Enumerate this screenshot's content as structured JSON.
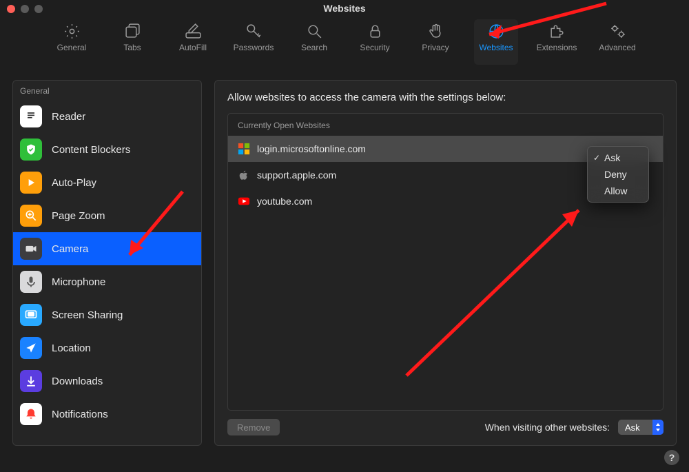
{
  "window": {
    "title": "Websites"
  },
  "toolbar": {
    "items": [
      {
        "id": "general",
        "label": "General"
      },
      {
        "id": "tabs",
        "label": "Tabs"
      },
      {
        "id": "autofill",
        "label": "AutoFill"
      },
      {
        "id": "passwords",
        "label": "Passwords"
      },
      {
        "id": "search",
        "label": "Search"
      },
      {
        "id": "security",
        "label": "Security"
      },
      {
        "id": "privacy",
        "label": "Privacy"
      },
      {
        "id": "websites",
        "label": "Websites",
        "selected": true
      },
      {
        "id": "extensions",
        "label": "Extensions"
      },
      {
        "id": "advanced",
        "label": "Advanced"
      }
    ]
  },
  "sidebar": {
    "section_label": "General",
    "items": [
      {
        "id": "reader",
        "label": "Reader"
      },
      {
        "id": "content-blockers",
        "label": "Content Blockers"
      },
      {
        "id": "auto-play",
        "label": "Auto-Play"
      },
      {
        "id": "page-zoom",
        "label": "Page Zoom"
      },
      {
        "id": "camera",
        "label": "Camera",
        "selected": true
      },
      {
        "id": "microphone",
        "label": "Microphone"
      },
      {
        "id": "screen-sharing",
        "label": "Screen Sharing"
      },
      {
        "id": "location",
        "label": "Location"
      },
      {
        "id": "downloads",
        "label": "Downloads"
      },
      {
        "id": "notifications",
        "label": "Notifications"
      }
    ]
  },
  "detail": {
    "heading": "Allow websites to access the camera with the settings below:",
    "list_header": "Currently Open Websites",
    "sites": [
      {
        "icon": "microsoft",
        "label": "login.microsoftonline.com",
        "selected": true
      },
      {
        "icon": "apple",
        "label": "support.apple.com"
      },
      {
        "icon": "youtube",
        "label": "youtube.com"
      }
    ],
    "remove_label": "Remove",
    "footer_label": "When visiting other websites:",
    "footer_select_value": "Ask"
  },
  "popup": {
    "items": [
      {
        "label": "Ask",
        "checked": true
      },
      {
        "label": "Deny"
      },
      {
        "label": "Allow"
      }
    ]
  },
  "help_glyph": "?"
}
